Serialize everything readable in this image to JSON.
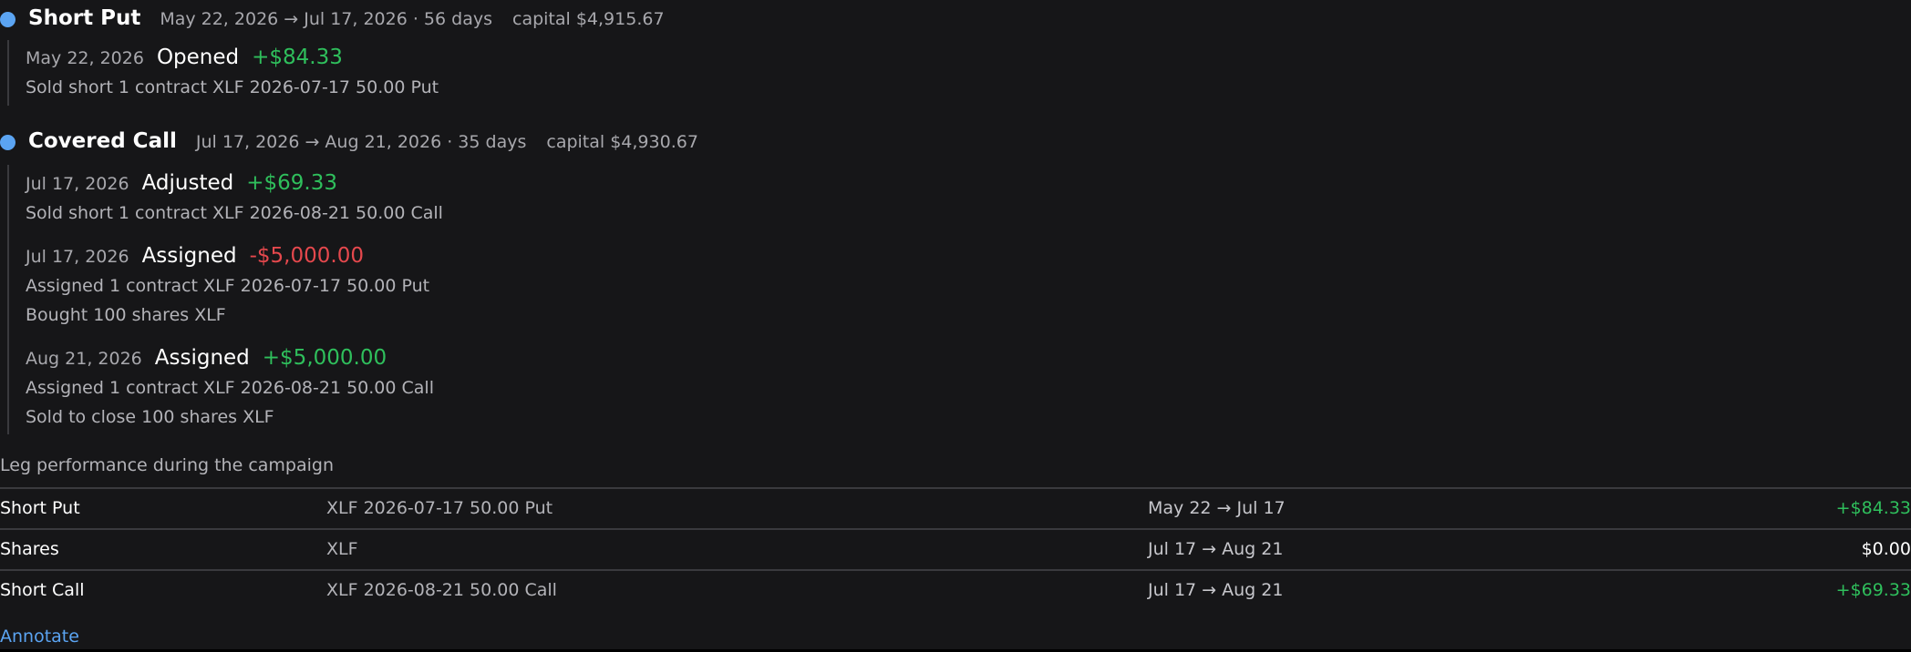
{
  "phases": [
    {
      "title": "Short Put",
      "range": "May 22, 2026 → Jul 17, 2026 · 56 days",
      "capital": "capital $4,915.67",
      "events": [
        {
          "date": "May 22, 2026",
          "type": "Opened",
          "amount": "+$84.33",
          "lines": [
            "Sold short 1 contract XLF 2026-07-17 50.00 Put"
          ]
        }
      ]
    },
    {
      "title": "Covered Call",
      "range": "Jul 17, 2026 → Aug 21, 2026 · 35 days",
      "capital": "capital $4,930.67",
      "events": [
        {
          "date": "Jul 17, 2026",
          "type": "Adjusted",
          "amount": "+$69.33",
          "lines": [
            "Sold short 1 contract XLF 2026-08-21 50.00 Call"
          ]
        },
        {
          "date": "Jul 17, 2026",
          "type": "Assigned",
          "amount": "-$5,000.00",
          "lines": [
            "Assigned 1 contract XLF 2026-07-17 50.00 Put",
            "Bought 100 shares XLF"
          ]
        },
        {
          "date": "Aug 21, 2026",
          "type": "Assigned",
          "amount": "+$5,000.00",
          "lines": [
            "Assigned 1 contract XLF 2026-08-21 50.00 Call",
            "Sold to close 100 shares XLF"
          ]
        }
      ]
    }
  ],
  "legs_section": {
    "label": "Leg performance during the campaign",
    "rows": [
      {
        "name": "Short Put",
        "instrument": "XLF 2026-07-17 50.00 Put",
        "range": "May 22 → Jul 17",
        "pnl": "+$84.33"
      },
      {
        "name": "Shares",
        "instrument": "XLF",
        "range": "Jul 17 → Aug 21",
        "pnl": "$0.00"
      },
      {
        "name": "Short Call",
        "instrument": "XLF 2026-08-21 50.00 Call",
        "range": "Jul 17 → Aug 21",
        "pnl": "+$69.33"
      }
    ]
  },
  "annotate_label": "Annotate",
  "colors": {
    "background": "#161618",
    "accent": "#5ba4f2",
    "positive": "#2fbf5c",
    "negative": "#e5484d"
  }
}
